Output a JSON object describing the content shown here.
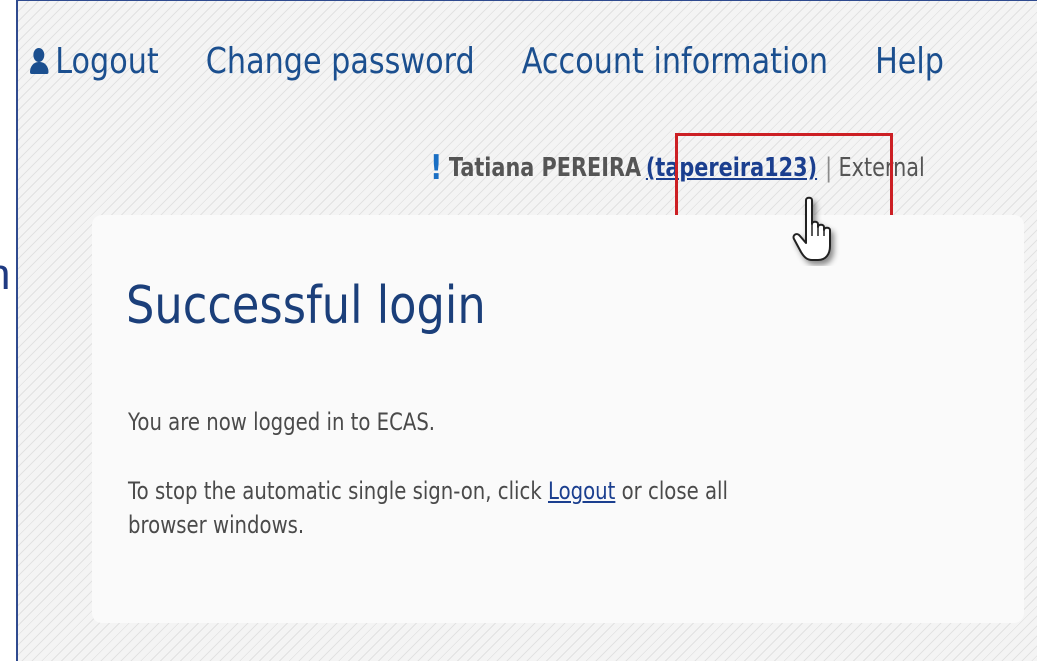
{
  "nav": {
    "logout": "Logout",
    "change_password": "Change password",
    "account_information": "Account information",
    "help": "Help"
  },
  "user": {
    "name": "Tatiana PEREIRA",
    "login": "(tapereira123)",
    "separator": "|",
    "type": "External"
  },
  "main": {
    "title": "Successful login",
    "message": "You are now logged in to ECAS.",
    "sso_prefix": "To stop the automatic single sign-on, click ",
    "sso_link": "Logout",
    "sso_suffix": " or close all",
    "sso_line2": "browser windows."
  },
  "edge_fragment": "n",
  "icons": {
    "logout_icon": "user-icon",
    "alert_icon": "exclamation-icon",
    "cursor": "hand-pointer-icon"
  },
  "colors": {
    "link": "#1b4f8f",
    "title": "#1b3f7a",
    "highlight": "#cc1f24",
    "alert": "#1a6fc4"
  }
}
